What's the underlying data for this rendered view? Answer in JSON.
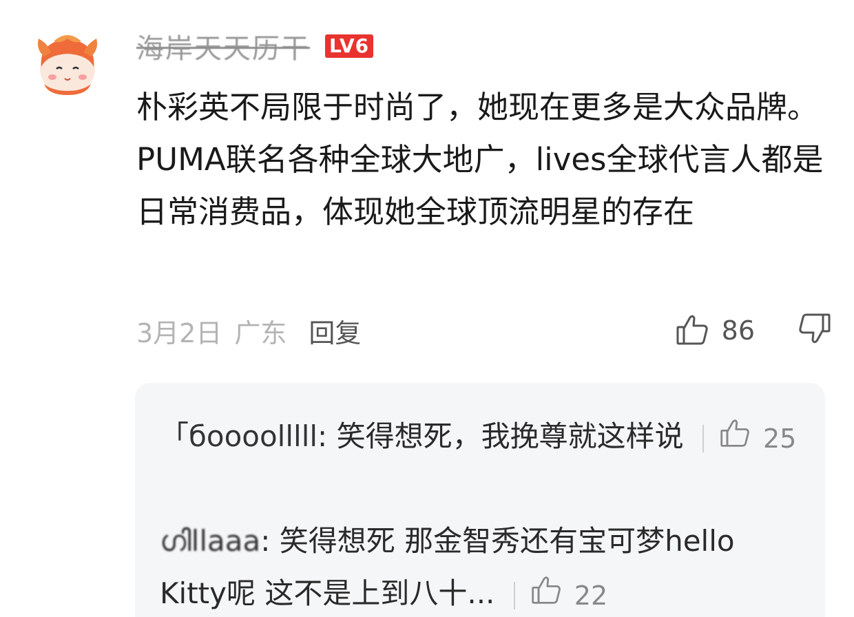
{
  "comment": {
    "username": "海岸天天历干",
    "level": "LV6",
    "text": "朴彩英不局限于时尚了，她现在更多是大众品牌。PUMA联名各种全球大地广，lives全球代言人都是日常消费品，体现她全球顶流明星的存在",
    "date": "3月2日",
    "location": "广东",
    "reply_label": "回复",
    "like_count": "86",
    "icons": {
      "like": "thumbs-up-icon",
      "dislike": "thumbs-down-icon"
    }
  },
  "replies": [
    {
      "user": "「бооооlllll",
      "text": "笑得想死，我挽尊就这样说",
      "like_count": "25"
    },
    {
      "user": "ഗിllaaa",
      "text": "笑得想死 那金智秀还有宝可梦hello Kitty呢 这不是上到八十...",
      "like_count": "22"
    }
  ],
  "colors": {
    "level_badge": "#e8332f",
    "reply_bg": "#f5f6f8"
  }
}
